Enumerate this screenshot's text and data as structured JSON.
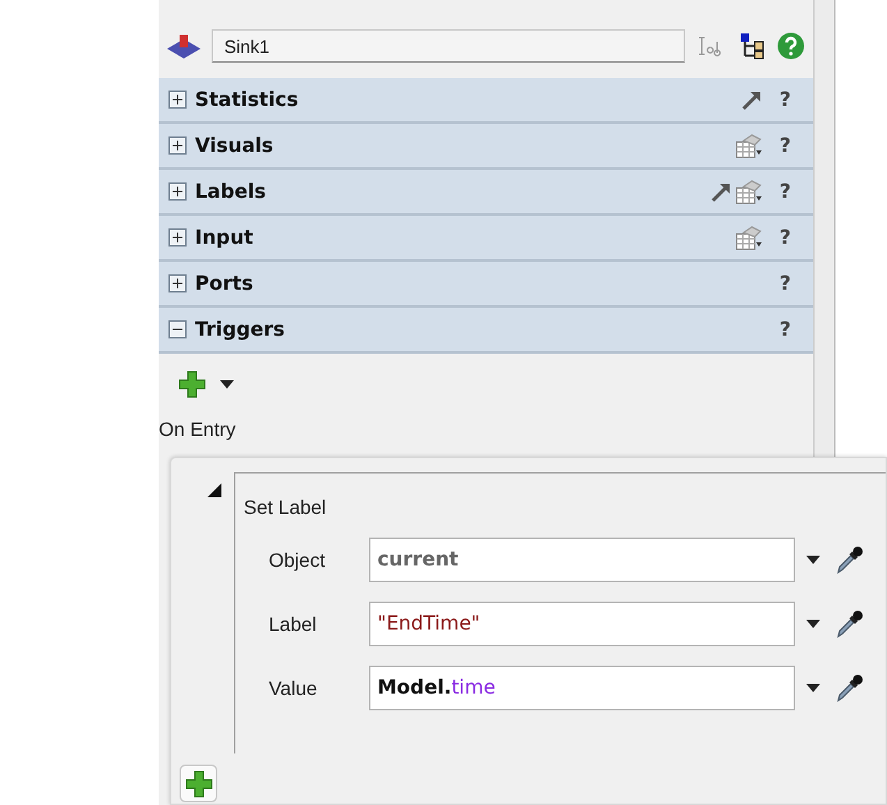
{
  "header": {
    "name": "Sink1"
  },
  "sections": [
    {
      "title": "Statistics",
      "expanded": false,
      "arrow_icon": true,
      "help": "?"
    },
    {
      "title": "Visuals",
      "expanded": false,
      "table_icon": true,
      "help": "?"
    },
    {
      "title": "Labels",
      "expanded": false,
      "arrow_icon": true,
      "table_icon": true,
      "help": "?"
    },
    {
      "title": "Input",
      "expanded": false,
      "table_icon": true,
      "help": "?"
    },
    {
      "title": "Ports",
      "expanded": false,
      "help": "?"
    },
    {
      "title": "Triggers",
      "expanded": true,
      "help": "?"
    }
  ],
  "triggers": {
    "event": "On Entry"
  },
  "popup": {
    "title": "Set Label",
    "fields": [
      {
        "label": "Object",
        "tokens": [
          {
            "text": "current",
            "kind": "keyword"
          }
        ]
      },
      {
        "label": "Label",
        "tokens": [
          {
            "text": "\"EndTime\"",
            "kind": "string"
          }
        ]
      },
      {
        "label": "Value",
        "tokens": [
          {
            "text": "Model.",
            "kind": "class"
          },
          {
            "text": "time",
            "kind": "property"
          }
        ]
      }
    ]
  }
}
